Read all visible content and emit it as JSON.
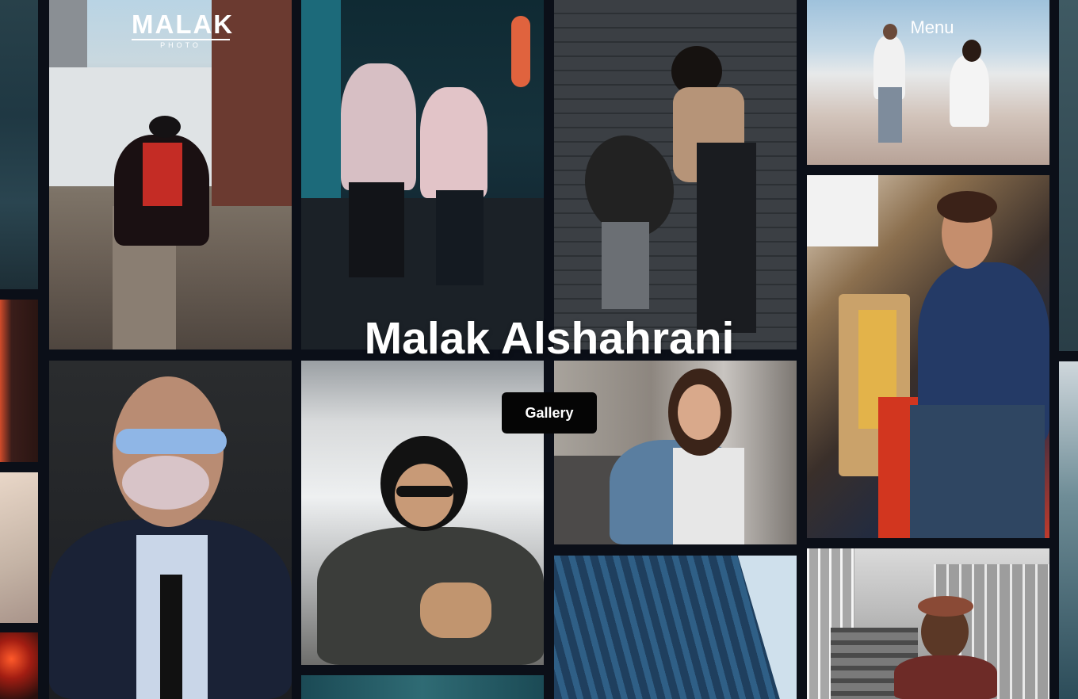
{
  "brand": {
    "logo_text": "MALAK",
    "logo_subtext": "PHOTO"
  },
  "nav": {
    "menu_label": "Menu"
  },
  "hero": {
    "name": "Malak Alshahrani",
    "gallery_label": "Gallery"
  },
  "colors": {
    "background": "#0b0f18",
    "text": "#ffffff",
    "button_background": "#050505"
  },
  "photos": [
    "train-window-photo",
    "neon-lights-photo",
    "beach-photo",
    "neon-sign-photo",
    "graduate-walking-photo",
    "bubblegum-portrait-photo",
    "neon-alley-couple-photo",
    "skyscraper-portrait-photo",
    "teal-street-photo",
    "brick-wall-boot-photo",
    "street-portrait-woman-photo",
    "blue-facade-photo",
    "beach-couple-photo",
    "24-hours-portrait-photo",
    "staircase-portrait-photo",
    "edge-photo-top",
    "edge-photo-bottom"
  ]
}
